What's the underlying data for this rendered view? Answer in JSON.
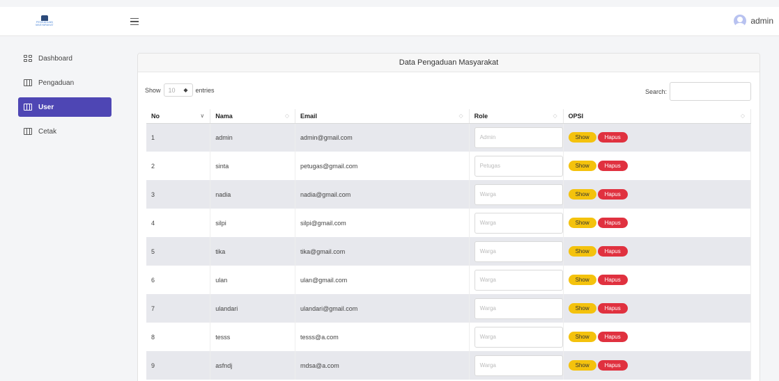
{
  "app": {
    "logo_text_1": "PENGADUAN",
    "logo_text_2": "MASYARAKAT",
    "user_name": "admin"
  },
  "sidebar": {
    "items": [
      {
        "label": "Dashboard",
        "icon": "grid-icon"
      },
      {
        "label": "Pengaduan",
        "icon": "columns-icon"
      },
      {
        "label": "User",
        "icon": "columns-icon",
        "active": true
      },
      {
        "label": "Cetak",
        "icon": "columns-icon"
      }
    ]
  },
  "card": {
    "title": "Data Pengaduan Masyarakat",
    "show_label": "Show",
    "length_value": "10",
    "entries_label": "entries",
    "search_label": "Search:",
    "search_value": ""
  },
  "table": {
    "headers": [
      "No",
      "Nama",
      "Email",
      "Role",
      "OPSI"
    ],
    "show_label": "Show",
    "hapus_label": "Hapus",
    "rows": [
      {
        "no": "1",
        "nama": "admin",
        "email": "admin@gmail.com",
        "role": "Admin"
      },
      {
        "no": "2",
        "nama": "sinta",
        "email": "petugas@gmail.com",
        "role": "Petugas"
      },
      {
        "no": "3",
        "nama": "nadia",
        "email": "nadia@gmail.com",
        "role": "Warga"
      },
      {
        "no": "4",
        "nama": "silpi",
        "email": "silpi@gmail.com",
        "role": "Warga"
      },
      {
        "no": "5",
        "nama": "tika",
        "email": "tika@gmail.com",
        "role": "Warga"
      },
      {
        "no": "6",
        "nama": "ulan",
        "email": "ulan@gmail.com",
        "role": "Warga"
      },
      {
        "no": "7",
        "nama": "ulandari",
        "email": "ulandari@gmail.com",
        "role": "Warga"
      },
      {
        "no": "8",
        "nama": "tesss",
        "email": "tesss@a.com",
        "role": "Warga"
      },
      {
        "no": "9",
        "nama": "asfndj",
        "email": "mdsa@a.com",
        "role": "Warga"
      }
    ]
  },
  "colors": {
    "primary": "#4e46b4",
    "show_button": "#f4c20d",
    "hapus_button": "#e0313f",
    "stripe": "#e7e8ed"
  }
}
